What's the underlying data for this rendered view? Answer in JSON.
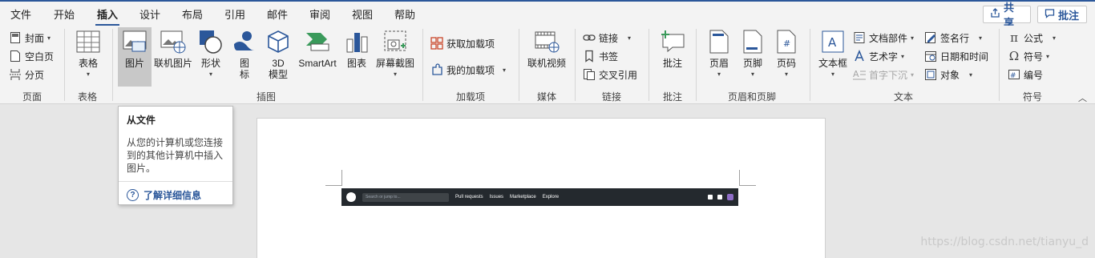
{
  "tabs": [
    "文件",
    "开始",
    "插入",
    "设计",
    "布局",
    "引用",
    "邮件",
    "审阅",
    "视图",
    "帮助"
  ],
  "active_tab": "插入",
  "share_label": "共享",
  "comment_label": "批注",
  "groups": {
    "pages": {
      "label": "页面",
      "cover": "封面",
      "blank": "空白页",
      "break": "分页"
    },
    "table": {
      "label": "表格",
      "table": "表格"
    },
    "illustrations": {
      "label": "插图",
      "picture": "图片",
      "online_picture": "联机图片",
      "shapes": "形状",
      "icons_l1": "图",
      "icons_l2": "标",
      "model3d_l1": "3D",
      "model3d_l2": "模型",
      "smartart": "SmartArt",
      "chart": "图表",
      "screenshot": "屏幕截图"
    },
    "addins": {
      "label": "加载项",
      "get": "获取加载项",
      "my": "我的加载项"
    },
    "media": {
      "label": "媒体",
      "online_video": "联机视频"
    },
    "links": {
      "label": "链接",
      "link": "链接",
      "bookmark": "书签",
      "crossref": "交叉引用"
    },
    "comments": {
      "label": "批注",
      "comment": "批注"
    },
    "header_footer": {
      "label": "页眉和页脚",
      "header": "页眉",
      "footer": "页脚",
      "page_number": "页码"
    },
    "text": {
      "label": "文本",
      "textbox": "文本框",
      "quick_parts": "文档部件",
      "wordart": "艺术字",
      "dropcap": "首字下沉",
      "signature": "签名行",
      "datetime": "日期和时间",
      "object": "对象"
    },
    "symbols": {
      "label": "符号",
      "equation": "公式",
      "symbol": "符号",
      "number": "编号"
    }
  },
  "tooltip": {
    "title": "从文件",
    "body": "从您的计算机或您连接到的其他计算机中插入图片。",
    "link": "了解详细信息"
  },
  "embedded_image": {
    "search_placeholder": "Search or jump to...",
    "links": [
      "Pull requests",
      "Issues",
      "Marketplace",
      "Explore"
    ]
  },
  "watermark": "https://blog.csdn.net/tianyu_d",
  "colors": {
    "accent": "#2b579a",
    "ribbon_bg": "#f3f3f3",
    "doc_bg": "#e6e6e6"
  }
}
